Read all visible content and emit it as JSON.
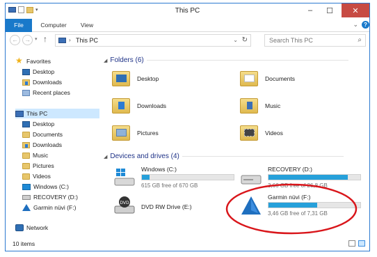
{
  "window": {
    "title": "This PC"
  },
  "ribbon": {
    "tabs": [
      "File",
      "Computer",
      "View"
    ]
  },
  "address": {
    "path": "This PC",
    "search_placeholder": "Search This PC"
  },
  "nav_pane": {
    "favorites_label": "Favorites",
    "favorites": [
      "Desktop",
      "Downloads",
      "Recent places"
    ],
    "this_pc_label": "This PC",
    "this_pc_items": [
      "Desktop",
      "Documents",
      "Downloads",
      "Music",
      "Pictures",
      "Videos",
      "Windows (C:)",
      "RECOVERY (D:)",
      "Garmin nüvi (F:)"
    ],
    "network_label": "Network"
  },
  "content": {
    "folders_header": "Folders (6)",
    "folders": [
      "Desktop",
      "Documents",
      "Downloads",
      "Music",
      "Pictures",
      "Videos"
    ],
    "devices_header": "Devices and drives (4)",
    "drives": [
      {
        "name": "Windows (C:)",
        "free": "615 GB free of 670 GB",
        "used_fraction": 0.08
      },
      {
        "name": "RECOVERY (D:)",
        "free": "3,66 GB free of 26,8 GB",
        "used_fraction": 0.86
      },
      {
        "name": "DVD RW Drive (E:)"
      },
      {
        "name": "Garmin nüvi (F:)",
        "free": "3,46 GB free of 7,31 GB",
        "used_fraction": 0.53
      }
    ]
  },
  "status": {
    "items": "10 items"
  },
  "colors": {
    "accent": "#1979ca",
    "bar_fill": "#26a0da",
    "highlight_circle": "#d9161b",
    "close_button": "#c74b43"
  }
}
